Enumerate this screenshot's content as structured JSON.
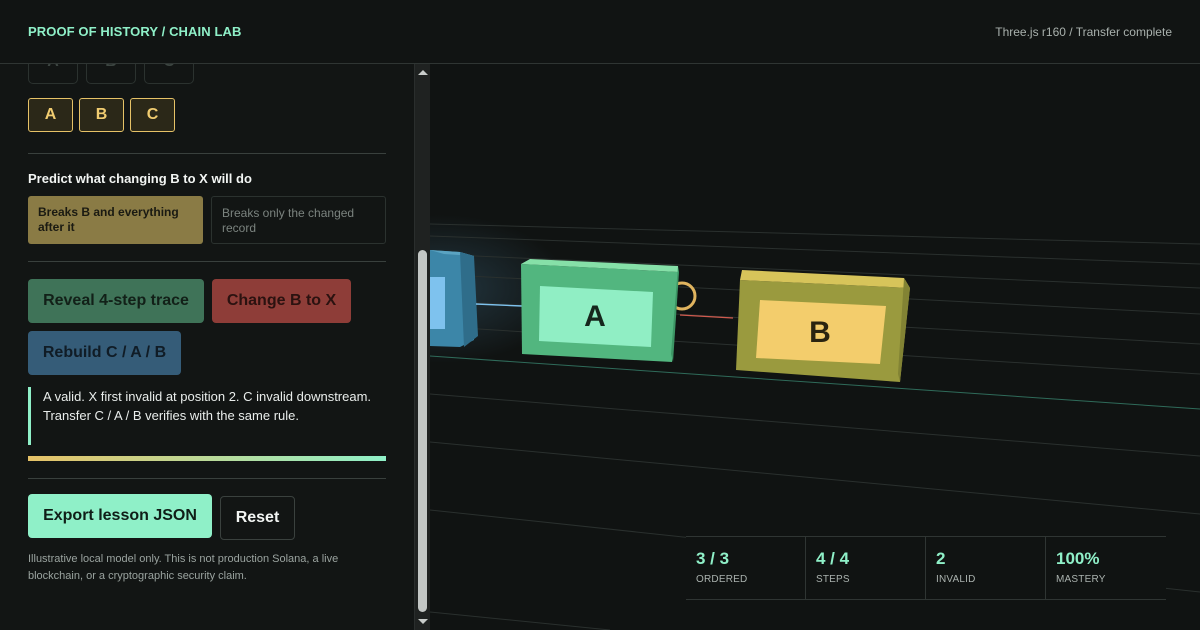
{
  "header": {
    "brand": "PROOF OF HISTORY / CHAIN LAB",
    "status": "Three.js r160 / Transfer complete"
  },
  "panel": {
    "ghost_chips": [
      "A",
      "B",
      "C"
    ],
    "order_chips": [
      "A",
      "B",
      "C"
    ],
    "predict": {
      "title": "Predict what changing B to X will do",
      "options": [
        "Breaks B and everything after it",
        "Breaks only the changed record"
      ],
      "selected": "Breaks B and everything after it"
    },
    "actions": {
      "reveal": "Reveal 4-step trace",
      "change": "Change B to X",
      "rebuild": "Rebuild C / A / B"
    },
    "explanation": "A valid. X first invalid at position 2. C invalid downstream. Transfer C / A / B verifies with the same rule.",
    "progress_fraction": 1.0,
    "export_label": "Export lesson JSON",
    "reset_label": "Reset",
    "disclaimer": "Illustrative local model only. This is not production Solana, a live blockchain, or a cryptographic security claim."
  },
  "scene": {
    "blocks": [
      {
        "label": "A",
        "color": "#5cc08a"
      },
      {
        "label": "B",
        "color": "#9a9a3e"
      }
    ]
  },
  "metrics": [
    {
      "value": "3 / 3",
      "label": "ORDERED"
    },
    {
      "value": "4 / 4",
      "label": "STEPS"
    },
    {
      "value": "2",
      "label": "INVALID"
    },
    {
      "value": "100%",
      "label": "MASTERY"
    }
  ],
  "colors": {
    "accent": "#8ff0c8",
    "gold": "#e6c267",
    "danger": "#8e3d38",
    "info": "#355c78"
  }
}
